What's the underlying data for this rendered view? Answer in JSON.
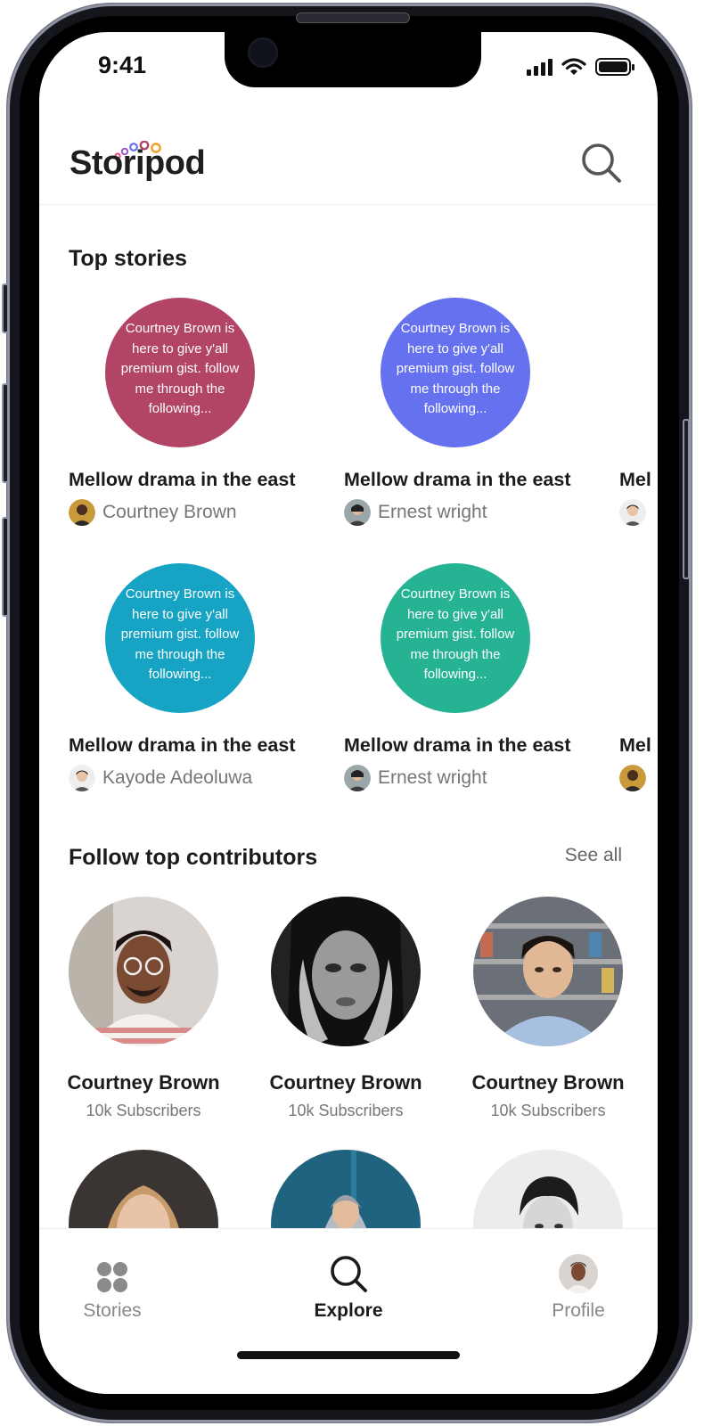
{
  "status_bar": {
    "time": "9:41"
  },
  "header": {
    "logo_text": "Storipod"
  },
  "top_stories": {
    "title": "Top stories",
    "items": [
      {
        "excerpt": "Courtney Brown is here to give y'all premium gist. follow me through the following...",
        "title": "Mellow drama in the east",
        "author": "Courtney Brown",
        "color": "#b24466"
      },
      {
        "excerpt": "Courtney Brown is here to give y'all premium gist. follow me through the following...",
        "title": "Mellow drama in the east",
        "author": "Ernest wright",
        "color": "#6571ee"
      },
      {
        "excerpt": "Courtney Brown is here to give y'all premium gist. follow me through the following...",
        "title": "Mellow drama in the east",
        "author": "Kayode Adeoluwa",
        "color": "#16a3c4"
      },
      {
        "excerpt": "Courtney Brown is here to give y'all premium gist. follow me through the following...",
        "title": "Mellow drama in the east",
        "author": "Ernest wright",
        "color": "#26b394"
      }
    ],
    "peek_title": "Mel"
  },
  "contributors": {
    "title": "Follow top contributors",
    "see_all": "See all",
    "items": [
      {
        "name": "Courtney Brown",
        "subscribers": "10k Subscribers"
      },
      {
        "name": "Courtney Brown",
        "subscribers": "10k Subscribers"
      },
      {
        "name": "Courtney Brown",
        "subscribers": "10k Subscribers"
      }
    ]
  },
  "bottom_nav": {
    "items": [
      {
        "label": "Stories",
        "icon": "grid-icon"
      },
      {
        "label": "Explore",
        "icon": "search-icon"
      },
      {
        "label": "Profile",
        "icon": "avatar"
      }
    ]
  }
}
